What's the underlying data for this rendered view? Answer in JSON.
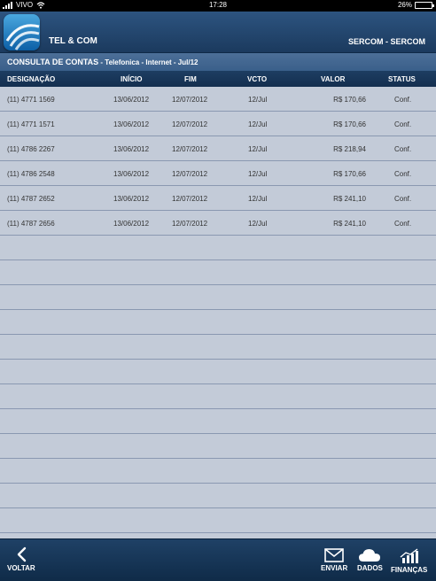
{
  "status_bar": {
    "carrier": "VIVO",
    "time": "17:28",
    "battery": "26%",
    "battery_level": 0.26
  },
  "header": {
    "app_title": "TEL & COM",
    "company": "SERCOM - SERCOM"
  },
  "subtitle": {
    "label": "CONSULTA DE CONTAS",
    "detail": " - Telefonica - Internet - Jul/12"
  },
  "columns": [
    "DESIGNAÇÃO",
    "INÍCIO",
    "FIM",
    "VCTO",
    "VALOR",
    "STATUS"
  ],
  "rows": [
    {
      "designacao": "(11) 4771 1569",
      "inicio": "13/06/2012",
      "fim": "12/07/2012",
      "vcto": "12/Jul",
      "valor": "R$ 170,66",
      "status": "Conf."
    },
    {
      "designacao": "(11) 4771 1571",
      "inicio": "13/06/2012",
      "fim": "12/07/2012",
      "vcto": "12/Jul",
      "valor": "R$ 170,66",
      "status": "Conf."
    },
    {
      "designacao": "(11) 4786 2267",
      "inicio": "13/06/2012",
      "fim": "12/07/2012",
      "vcto": "12/Jul",
      "valor": "R$ 218,94",
      "status": "Conf."
    },
    {
      "designacao": "(11) 4786 2548",
      "inicio": "13/06/2012",
      "fim": "12/07/2012",
      "vcto": "12/Jul",
      "valor": "R$ 170,66",
      "status": "Conf."
    },
    {
      "designacao": "(11) 4787 2652",
      "inicio": "13/06/2012",
      "fim": "12/07/2012",
      "vcto": "12/Jul",
      "valor": "R$ 241,10",
      "status": "Conf."
    },
    {
      "designacao": "(11) 4787 2656",
      "inicio": "13/06/2012",
      "fim": "12/07/2012",
      "vcto": "12/Jul",
      "valor": "R$ 241,10",
      "status": "Conf."
    }
  ],
  "toolbar": {
    "back": "VOLTAR",
    "enviar": "ENVIAR",
    "dados": "DADOS",
    "financas": "FINANÇAS"
  },
  "icons": {
    "back": "chevron-left-icon",
    "enviar": "envelope-icon",
    "dados": "cloud-icon",
    "financas": "chart-icon",
    "logo": "app-logo-icon"
  },
  "colors": {
    "header": "#1b3a5e",
    "table_bg": "#c3cbd8",
    "row_border": "#8a98b1",
    "toolbar": "#0f2b48"
  }
}
